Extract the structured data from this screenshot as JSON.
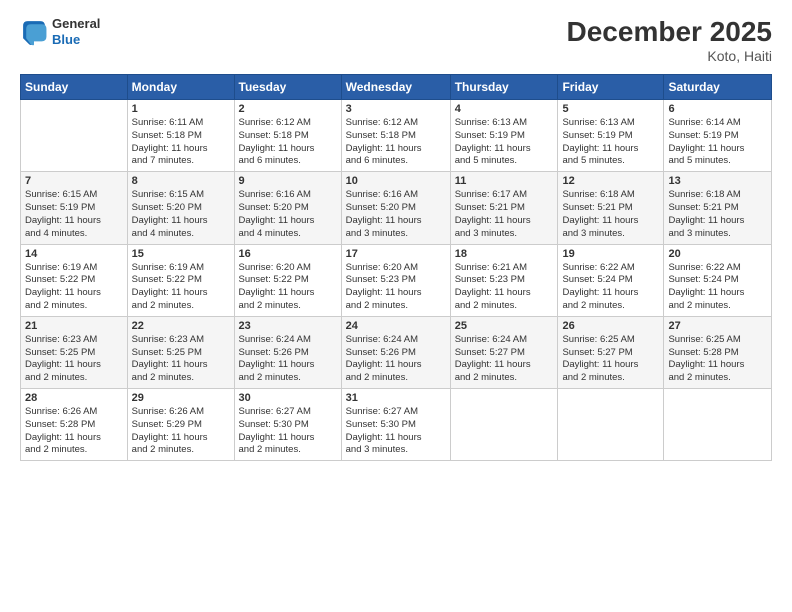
{
  "logo": {
    "general": "General",
    "blue": "Blue"
  },
  "header": {
    "title": "December 2025",
    "subtitle": "Koto, Haiti"
  },
  "days_of_week": [
    "Sunday",
    "Monday",
    "Tuesday",
    "Wednesday",
    "Thursday",
    "Friday",
    "Saturday"
  ],
  "weeks": [
    [
      {
        "day": "",
        "info": ""
      },
      {
        "day": "1",
        "info": "Sunrise: 6:11 AM\nSunset: 5:18 PM\nDaylight: 11 hours\nand 7 minutes."
      },
      {
        "day": "2",
        "info": "Sunrise: 6:12 AM\nSunset: 5:18 PM\nDaylight: 11 hours\nand 6 minutes."
      },
      {
        "day": "3",
        "info": "Sunrise: 6:12 AM\nSunset: 5:18 PM\nDaylight: 11 hours\nand 6 minutes."
      },
      {
        "day": "4",
        "info": "Sunrise: 6:13 AM\nSunset: 5:19 PM\nDaylight: 11 hours\nand 5 minutes."
      },
      {
        "day": "5",
        "info": "Sunrise: 6:13 AM\nSunset: 5:19 PM\nDaylight: 11 hours\nand 5 minutes."
      },
      {
        "day": "6",
        "info": "Sunrise: 6:14 AM\nSunset: 5:19 PM\nDaylight: 11 hours\nand 5 minutes."
      }
    ],
    [
      {
        "day": "7",
        "info": "Sunrise: 6:15 AM\nSunset: 5:19 PM\nDaylight: 11 hours\nand 4 minutes."
      },
      {
        "day": "8",
        "info": "Sunrise: 6:15 AM\nSunset: 5:20 PM\nDaylight: 11 hours\nand 4 minutes."
      },
      {
        "day": "9",
        "info": "Sunrise: 6:16 AM\nSunset: 5:20 PM\nDaylight: 11 hours\nand 4 minutes."
      },
      {
        "day": "10",
        "info": "Sunrise: 6:16 AM\nSunset: 5:20 PM\nDaylight: 11 hours\nand 3 minutes."
      },
      {
        "day": "11",
        "info": "Sunrise: 6:17 AM\nSunset: 5:21 PM\nDaylight: 11 hours\nand 3 minutes."
      },
      {
        "day": "12",
        "info": "Sunrise: 6:18 AM\nSunset: 5:21 PM\nDaylight: 11 hours\nand 3 minutes."
      },
      {
        "day": "13",
        "info": "Sunrise: 6:18 AM\nSunset: 5:21 PM\nDaylight: 11 hours\nand 3 minutes."
      }
    ],
    [
      {
        "day": "14",
        "info": "Sunrise: 6:19 AM\nSunset: 5:22 PM\nDaylight: 11 hours\nand 2 minutes."
      },
      {
        "day": "15",
        "info": "Sunrise: 6:19 AM\nSunset: 5:22 PM\nDaylight: 11 hours\nand 2 minutes."
      },
      {
        "day": "16",
        "info": "Sunrise: 6:20 AM\nSunset: 5:22 PM\nDaylight: 11 hours\nand 2 minutes."
      },
      {
        "day": "17",
        "info": "Sunrise: 6:20 AM\nSunset: 5:23 PM\nDaylight: 11 hours\nand 2 minutes."
      },
      {
        "day": "18",
        "info": "Sunrise: 6:21 AM\nSunset: 5:23 PM\nDaylight: 11 hours\nand 2 minutes."
      },
      {
        "day": "19",
        "info": "Sunrise: 6:22 AM\nSunset: 5:24 PM\nDaylight: 11 hours\nand 2 minutes."
      },
      {
        "day": "20",
        "info": "Sunrise: 6:22 AM\nSunset: 5:24 PM\nDaylight: 11 hours\nand 2 minutes."
      }
    ],
    [
      {
        "day": "21",
        "info": "Sunrise: 6:23 AM\nSunset: 5:25 PM\nDaylight: 11 hours\nand 2 minutes."
      },
      {
        "day": "22",
        "info": "Sunrise: 6:23 AM\nSunset: 5:25 PM\nDaylight: 11 hours\nand 2 minutes."
      },
      {
        "day": "23",
        "info": "Sunrise: 6:24 AM\nSunset: 5:26 PM\nDaylight: 11 hours\nand 2 minutes."
      },
      {
        "day": "24",
        "info": "Sunrise: 6:24 AM\nSunset: 5:26 PM\nDaylight: 11 hours\nand 2 minutes."
      },
      {
        "day": "25",
        "info": "Sunrise: 6:24 AM\nSunset: 5:27 PM\nDaylight: 11 hours\nand 2 minutes."
      },
      {
        "day": "26",
        "info": "Sunrise: 6:25 AM\nSunset: 5:27 PM\nDaylight: 11 hours\nand 2 minutes."
      },
      {
        "day": "27",
        "info": "Sunrise: 6:25 AM\nSunset: 5:28 PM\nDaylight: 11 hours\nand 2 minutes."
      }
    ],
    [
      {
        "day": "28",
        "info": "Sunrise: 6:26 AM\nSunset: 5:28 PM\nDaylight: 11 hours\nand 2 minutes."
      },
      {
        "day": "29",
        "info": "Sunrise: 6:26 AM\nSunset: 5:29 PM\nDaylight: 11 hours\nand 2 minutes."
      },
      {
        "day": "30",
        "info": "Sunrise: 6:27 AM\nSunset: 5:30 PM\nDaylight: 11 hours\nand 2 minutes."
      },
      {
        "day": "31",
        "info": "Sunrise: 6:27 AM\nSunset: 5:30 PM\nDaylight: 11 hours\nand 3 minutes."
      },
      {
        "day": "",
        "info": ""
      },
      {
        "day": "",
        "info": ""
      },
      {
        "day": "",
        "info": ""
      }
    ]
  ]
}
